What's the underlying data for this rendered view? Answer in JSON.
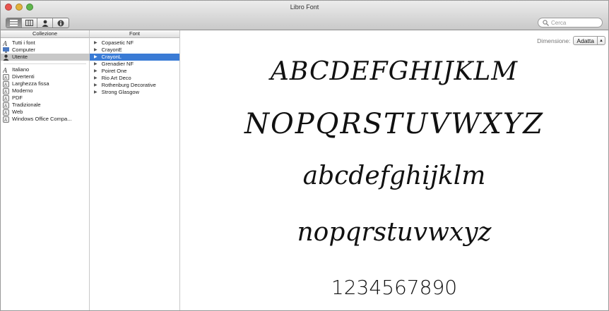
{
  "window": {
    "title": "Libro Font"
  },
  "toolbar": {
    "view_buttons": [
      "list-view-icon",
      "columns-view-icon",
      "user-icon",
      "info-icon"
    ],
    "search": {
      "placeholder": "Cerca"
    }
  },
  "collections": {
    "header": "Collezione",
    "group1": [
      {
        "label": "Tutti i font",
        "icon": "font-collection-icon"
      },
      {
        "label": "Computer",
        "icon": "computer-icon"
      },
      {
        "label": "Utente",
        "icon": "user-icon",
        "selected": true
      }
    ],
    "group2": [
      {
        "label": "Italiano",
        "icon": "font-collection-icon"
      },
      {
        "label": "Divertenti",
        "icon": "smart-collection-icon"
      },
      {
        "label": "Larghezza fissa",
        "icon": "smart-collection-icon"
      },
      {
        "label": "Moderno",
        "icon": "smart-collection-icon"
      },
      {
        "label": "PDF",
        "icon": "smart-collection-icon"
      },
      {
        "label": "Tradizionale",
        "icon": "smart-collection-icon"
      },
      {
        "label": "Web",
        "icon": "smart-collection-icon"
      },
      {
        "label": "Windows Office Compa...",
        "icon": "smart-collection-icon"
      }
    ]
  },
  "fonts": {
    "header": "Font",
    "items": [
      {
        "label": "Copasetic NF"
      },
      {
        "label": "CrayonE"
      },
      {
        "label": "CrayonL",
        "selected": true
      },
      {
        "label": "Grenadier NF"
      },
      {
        "label": "Poiret One"
      },
      {
        "label": "Rio Art Deco"
      },
      {
        "label": "Rothenburg Decorative"
      },
      {
        "label": "Strong Glasgow"
      }
    ]
  },
  "preview": {
    "size_label": "Dimensione:",
    "size_value": "Adatta",
    "lines": [
      "ABCDEFGHIJKLM",
      "NOPQRSTUVWXYZ",
      "abcdefghijklm",
      "nopqrstuvwxyz",
      "1234567890"
    ]
  },
  "colors": {
    "selection_blue": "#3a7bd5",
    "selection_gray": "#c8c8c8"
  }
}
